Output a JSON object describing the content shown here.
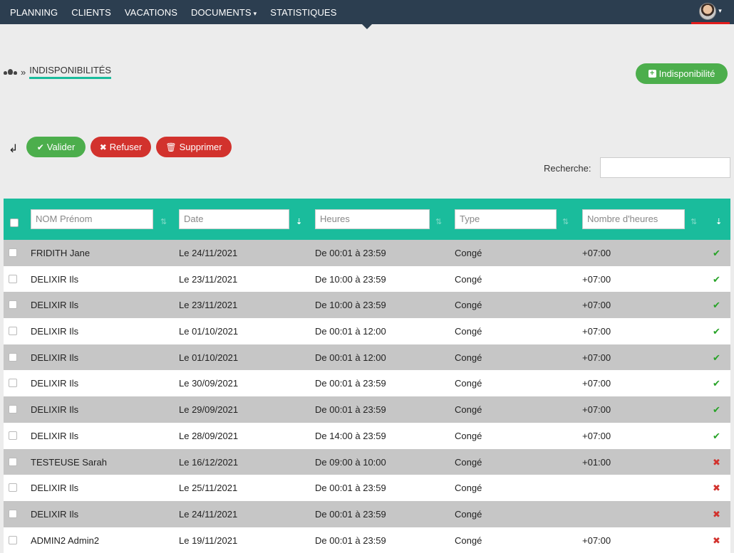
{
  "nav": {
    "items": [
      {
        "label": "PLANNING"
      },
      {
        "label": "CLIENTS"
      },
      {
        "label": "VACATIONS"
      },
      {
        "label": "DOCUMENTS",
        "caret": "▾"
      },
      {
        "label": "STATISTIQUES"
      }
    ]
  },
  "breadcrumb": {
    "separator": "»",
    "current": "INDISPONIBILITÉS"
  },
  "actions": {
    "add_label": "Indisponibilité",
    "valider_label": "Valider",
    "refuser_label": "Refuser",
    "supprimer_label": "Supprimer"
  },
  "search": {
    "label": "Recherche:",
    "value": ""
  },
  "table": {
    "filters": {
      "name": "NOM Prénom",
      "date": "Date",
      "hours": "Heures",
      "type": "Type",
      "nb": "Nombre d'heures"
    },
    "rows": [
      {
        "name": "FRIDITH Jane",
        "date": "Le 24/11/2021",
        "hours": "De 00:01 à 23:59",
        "type": "Congé",
        "nb": "+07:00",
        "status": "validated"
      },
      {
        "name": "DELIXIR Ils",
        "date": "Le 23/11/2021",
        "hours": "De 10:00 à 23:59",
        "type": "Congé",
        "nb": "+07:00",
        "status": "validated"
      },
      {
        "name": "DELIXIR Ils",
        "date": "Le 23/11/2021",
        "hours": "De 10:00 à 23:59",
        "type": "Congé",
        "nb": "+07:00",
        "status": "validated"
      },
      {
        "name": "DELIXIR Ils",
        "date": "Le 01/10/2021",
        "hours": "De 00:01 à 12:00",
        "type": "Congé",
        "nb": "+07:00",
        "status": "validated"
      },
      {
        "name": "DELIXIR Ils",
        "date": "Le 01/10/2021",
        "hours": "De 00:01 à 12:00",
        "type": "Congé",
        "nb": "+07:00",
        "status": "validated"
      },
      {
        "name": "DELIXIR Ils",
        "date": "Le 30/09/2021",
        "hours": "De 00:01 à 23:59",
        "type": "Congé",
        "nb": "+07:00",
        "status": "validated"
      },
      {
        "name": "DELIXIR Ils",
        "date": "Le 29/09/2021",
        "hours": "De 00:01 à 23:59",
        "type": "Congé",
        "nb": "+07:00",
        "status": "validated"
      },
      {
        "name": "DELIXIR Ils",
        "date": "Le 28/09/2021",
        "hours": "De 14:00 à 23:59",
        "type": "Congé",
        "nb": "+07:00",
        "status": "validated"
      },
      {
        "name": "TESTEUSE Sarah",
        "date": "Le 16/12/2021",
        "hours": "De 09:00 à 10:00",
        "type": "Congé",
        "nb": "+01:00",
        "status": "refused"
      },
      {
        "name": "DELIXIR Ils",
        "date": "Le 25/11/2021",
        "hours": "De 00:01 à 23:59",
        "type": "Congé",
        "nb": "",
        "status": "refused"
      },
      {
        "name": "DELIXIR Ils",
        "date": "Le 24/11/2021",
        "hours": "De 00:01 à 23:59",
        "type": "Congé",
        "nb": "",
        "status": "refused"
      },
      {
        "name": "ADMIN2 Admin2",
        "date": "Le 19/11/2021",
        "hours": "De 00:01 à 23:59",
        "type": "Congé",
        "nb": "+07:00",
        "status": "refused"
      }
    ]
  },
  "colors": {
    "topbar": "#2c3e50",
    "accent": "#1abc9c",
    "success": "#4cae4c",
    "danger": "#d2322d"
  }
}
